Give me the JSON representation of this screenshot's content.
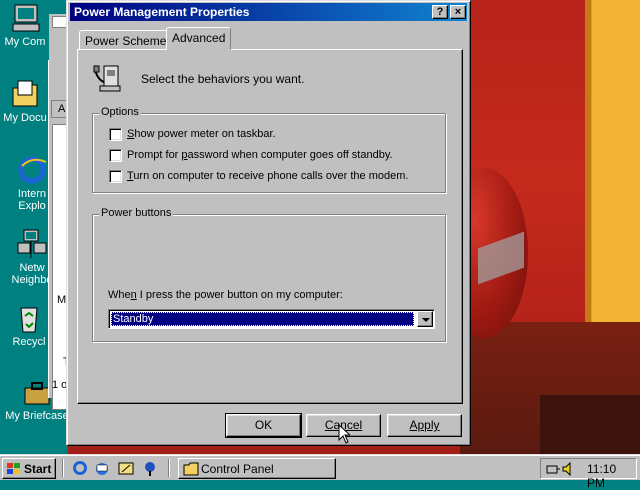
{
  "desktop": {
    "icons": [
      {
        "label": "My Com",
        "icon": "my-computer-icon"
      },
      {
        "label": "My Docu",
        "icon": "my-documents-icon"
      },
      {
        "label_line1": "Intern",
        "label_line2": "Explo",
        "icon": "internet-explorer-icon"
      },
      {
        "label_line1": "Netw",
        "label_line2": "Neighbo",
        "icon": "network-neighborhood-icon"
      },
      {
        "label": "Recycl",
        "icon": "recycle-bin-icon"
      },
      {
        "label": "My Briefcase",
        "icon": "briefcase-icon"
      }
    ],
    "background_window": {
      "frag_a": "A",
      "frag_m": "M",
      "frag_t": "T",
      "frag_1": "1 o"
    }
  },
  "dialog": {
    "title": "Power Management Properties",
    "help_button": "?",
    "close_button": "×",
    "tabs": [
      {
        "label": "Power Schemes",
        "active": false
      },
      {
        "label": "Advanced",
        "active": true
      }
    ],
    "header_text": "Select the behaviors you want.",
    "options_group": {
      "legend": "Options",
      "checkboxes": [
        {
          "pre": "",
          "ul": "S",
          "post": "how power meter on taskbar.",
          "checked": false
        },
        {
          "pre": "Prompt for ",
          "ul": "p",
          "post": "assword when computer goes off standby.",
          "checked": false
        },
        {
          "pre": "",
          "ul": "T",
          "post": "urn on computer to receive phone calls over the modem.",
          "checked": false
        }
      ]
    },
    "power_buttons_group": {
      "legend": "Power buttons",
      "label_pre": "Whe",
      "label_ul": "n",
      "label_post": " I press the power button on my computer:",
      "selected": "Standby"
    },
    "buttons": {
      "ok": "OK",
      "cancel": "Cancel",
      "apply": "Apply"
    }
  },
  "taskbar": {
    "start": "Start",
    "task": "Control Panel",
    "clock": "11:10 PM"
  },
  "colors": {
    "titlebar_start": "#000080",
    "titlebar_end": "#1084d0",
    "desktop": "#008080"
  }
}
